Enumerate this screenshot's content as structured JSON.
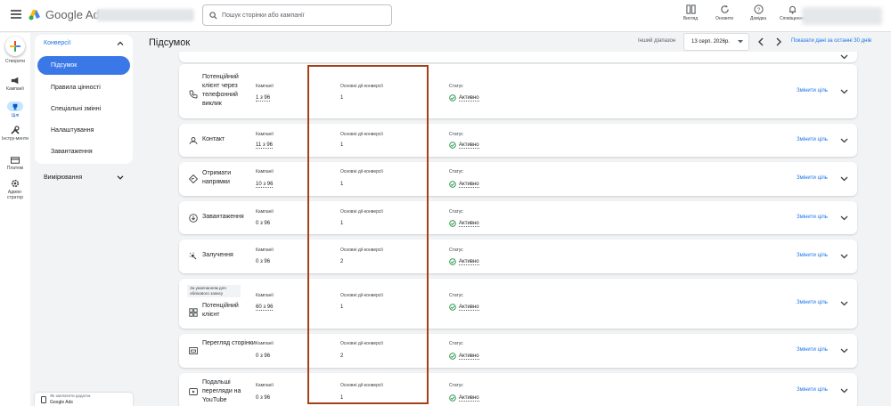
{
  "header": {
    "logo_text": "Google Ads",
    "search_placeholder": "Пошук сторінки або кампанії",
    "actions": [
      {
        "label": "Вигляд",
        "icon": "view-icon"
      },
      {
        "label": "Оновити",
        "icon": "refresh-icon"
      },
      {
        "label": "Довідка",
        "icon": "help-icon"
      },
      {
        "label": "Сповіщення",
        "icon": "bell-icon"
      }
    ]
  },
  "rail": {
    "items": [
      {
        "label": "Створити",
        "icon": "plus-icon"
      },
      {
        "label": "Кампанії",
        "icon": "megaphone-icon"
      },
      {
        "label": "Цілі",
        "icon": "trophy-icon"
      },
      {
        "label": "Інстру-менти",
        "icon": "tools-icon"
      },
      {
        "label": "Платежі",
        "icon": "card-icon"
      },
      {
        "label": "Адміні-стратор",
        "icon": "gear-icon"
      }
    ]
  },
  "subnav": {
    "section": "Конверсії",
    "items": [
      "Підсумок",
      "Правила цінності",
      "Спеціальні змінні",
      "Налаштування",
      "Завантаження"
    ],
    "section2": "Вимірювання"
  },
  "page": {
    "title": "Підсумок"
  },
  "date_range": {
    "label": "Інший діапазон",
    "value": "13 серп. 2026р.",
    "show_last": "Показати дані за останні 30 днів"
  },
  "columns": {
    "campaigns": "Кампанії",
    "primary_actions": "Основні дії-конверсії",
    "status": "Статус"
  },
  "rows": [
    {
      "name": "Потенційний клієнт через телефонний виклик",
      "icon": "phone-icon",
      "campaigns": "1 з 96",
      "actions": "1",
      "status": "Активно",
      "change": "Змінити ціль"
    },
    {
      "name": "Контакт",
      "icon": "contact-icon",
      "campaigns": "11 з 96",
      "actions": "1",
      "status": "Активно",
      "change": "Змінити ціль"
    },
    {
      "name": "Отримати напрямки",
      "icon": "directions-icon",
      "campaigns": "10 з 96",
      "actions": "1",
      "status": "Активно",
      "change": "Змінити ціль"
    },
    {
      "name": "Завантаження",
      "icon": "download-icon",
      "campaigns": "0 з 96",
      "actions": "1",
      "status": "Активно",
      "change": "Змінити ціль"
    },
    {
      "name": "Залучення",
      "icon": "engagement-icon",
      "campaigns": "0 з 96",
      "actions": "2",
      "status": "Активно",
      "change": "Змінити ціль"
    },
    {
      "name": "Потенційний клієнт",
      "badge": "За умовчанням для облікового запису",
      "icon": "lead-icon",
      "campaigns": "60 з 96",
      "actions": "1",
      "status": "Активно",
      "change": "Змінити ціль"
    },
    {
      "name": "Перегляд сторінки",
      "icon": "pageview-icon",
      "campaigns": "0 з 96",
      "actions": "2",
      "status": "Активно",
      "change": "Змінити ціль"
    },
    {
      "name": "Подальші перегляди на YouTube",
      "icon": "youtube-icon",
      "campaigns": "0 з 96",
      "actions": "1",
      "status": "Активно",
      "change": "Змінити ціль"
    }
  ],
  "widget": {
    "line1": "Як заплатити додаток",
    "line2": "Google Ads"
  },
  "colors": {
    "accent": "#1a73e8",
    "highlight": "#a5401b",
    "success": "#1e8e3e"
  }
}
